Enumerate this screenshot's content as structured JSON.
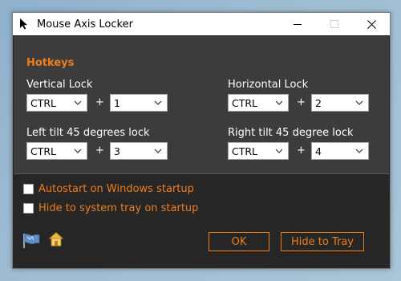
{
  "window": {
    "title": "Mouse Axis Locker",
    "icons": {
      "app": "mouse-cursor-icon",
      "minimize": "minimize-icon",
      "maximize": "maximize-icon",
      "close": "close-icon"
    }
  },
  "hotkeys": {
    "section_title": "Hotkeys",
    "plus": "+",
    "groups": [
      {
        "label": "Vertical Lock",
        "modifier": "CTRL",
        "key": "1"
      },
      {
        "label": "Horizontal Lock",
        "modifier": "CTRL",
        "key": "2"
      },
      {
        "label": "Left tilt 45 degrees lock",
        "modifier": "CTRL",
        "key": "3"
      },
      {
        "label": "Right tilt 45 degree lock",
        "modifier": "CTRL",
        "key": "4"
      }
    ]
  },
  "options": {
    "autostart": {
      "label": "Autostart on Windows startup",
      "checked": false
    },
    "hide_tray": {
      "label": "Hide to system tray on startup",
      "checked": false
    }
  },
  "buttons": {
    "ok": "OK",
    "hide_to_tray": "Hide to Tray"
  },
  "footer_icons": [
    "flag-icon",
    "home-icon"
  ],
  "colors": {
    "accent": "#f07e1b",
    "panel": "#3c3c3c",
    "window_bg": "#262626"
  }
}
